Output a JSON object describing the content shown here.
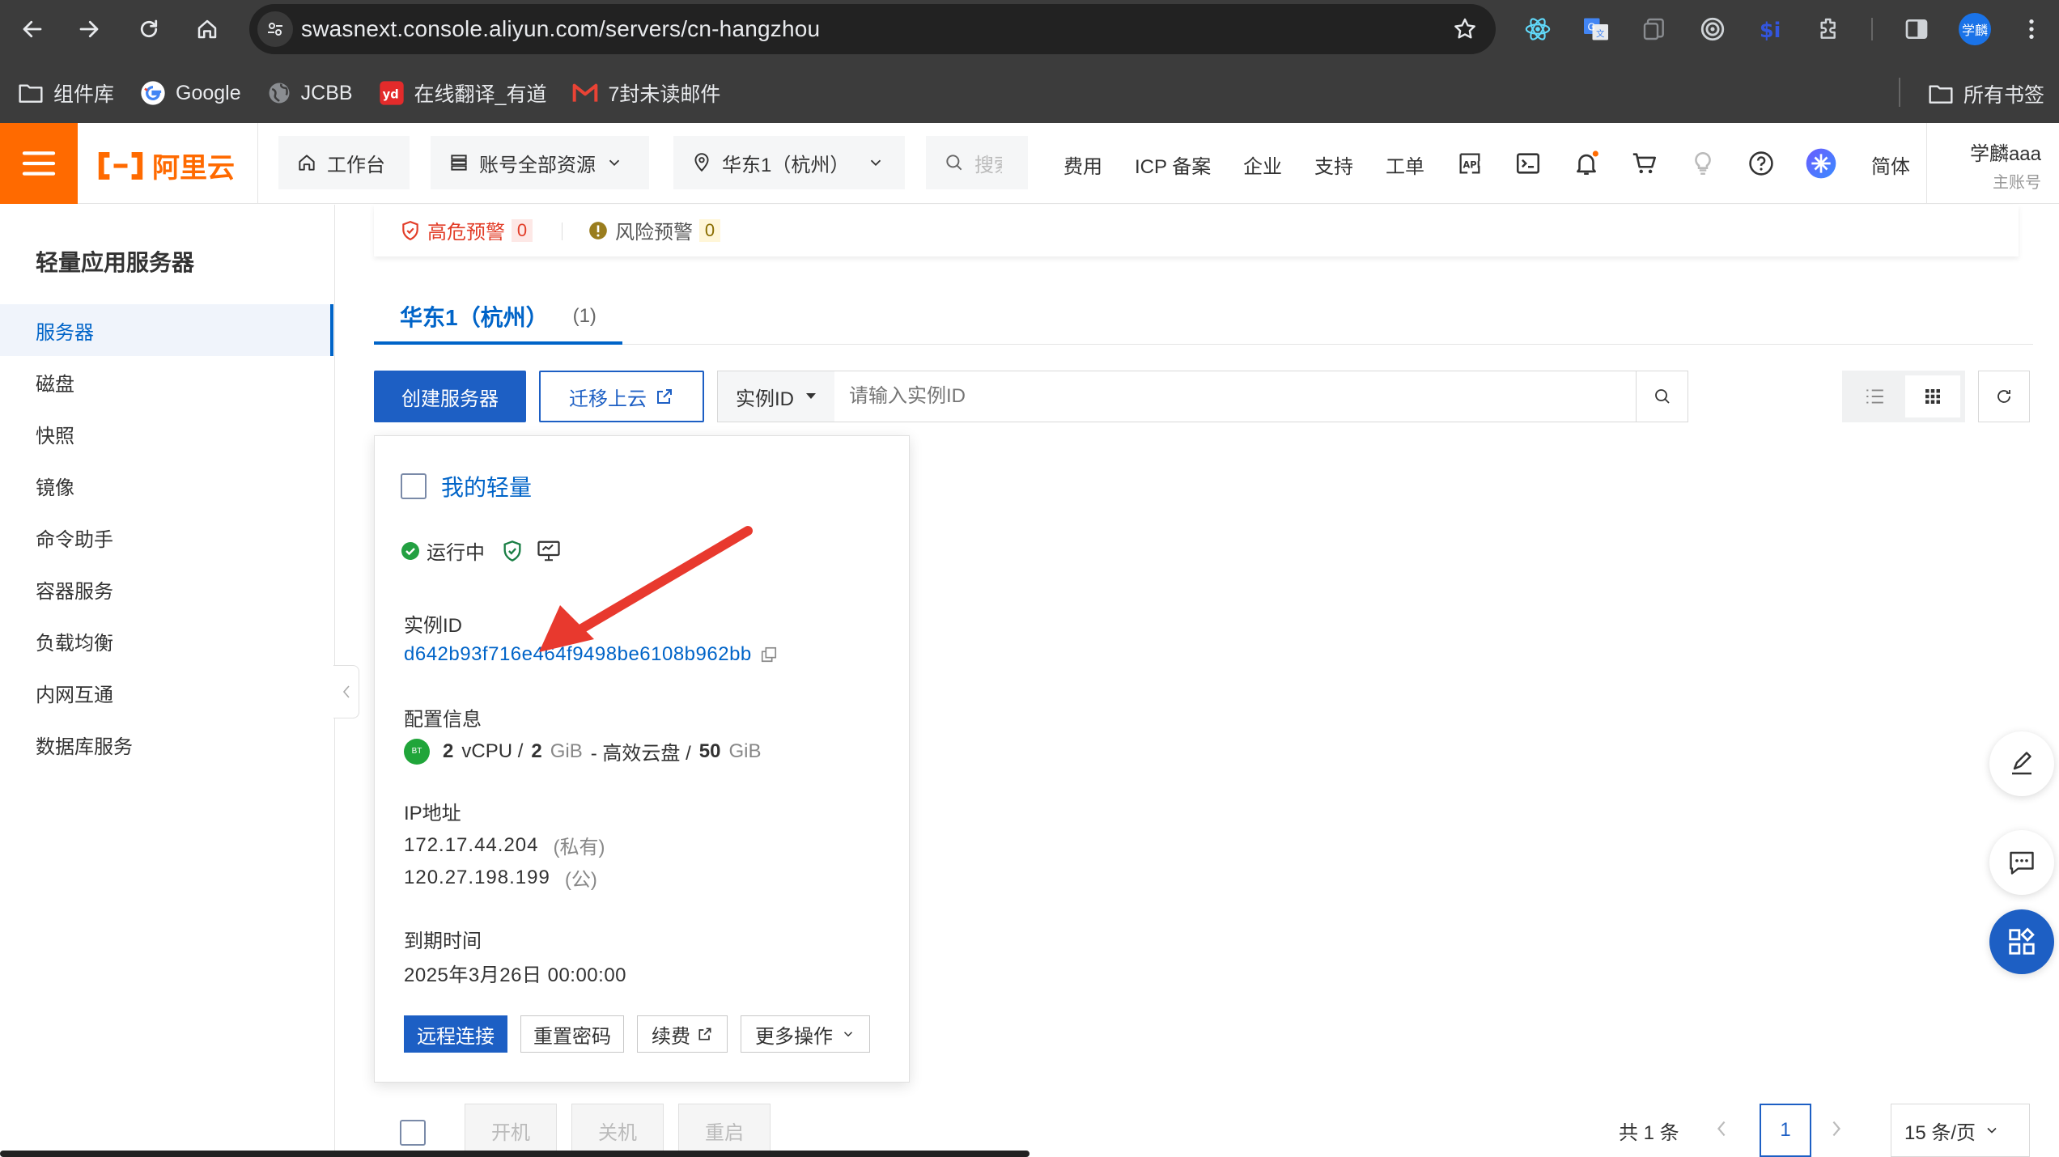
{
  "browser": {
    "url": "swasnext.console.aliyun.com/servers/cn-hangzhou",
    "bookmarks": [
      {
        "label": "组件库",
        "icon": "folder-icon"
      },
      {
        "label": "Google",
        "icon": "google-icon"
      },
      {
        "label": "JCBB",
        "icon": "globe-icon"
      },
      {
        "label": "在线翻译_有道",
        "icon": "youdao-icon"
      },
      {
        "label": "7封未读邮件",
        "icon": "mail-icon"
      }
    ],
    "all_bookmarks": "所有书签",
    "profile_initials": "学麟"
  },
  "header": {
    "logo": "阿里云",
    "workbench": "工作台",
    "resources": "账号全部资源",
    "region": "华东1（杭州）",
    "search_placeholder": "搜索",
    "links": [
      "费用",
      "ICP 备案",
      "企业",
      "支持",
      "工单"
    ],
    "language": "简体",
    "user_name": "学麟aaa",
    "user_role": "主账号"
  },
  "sidebar": {
    "title": "轻量应用服务器",
    "items": [
      "服务器",
      "磁盘",
      "快照",
      "镜像",
      "命令助手",
      "容器服务",
      "负载均衡",
      "内网互通",
      "数据库服务"
    ]
  },
  "alerts": {
    "high_label": "高危预警",
    "high_count": "0",
    "risk_label": "风险预警",
    "risk_count": "0"
  },
  "region_tab": {
    "name": "华东1（杭州）",
    "count": "(1)"
  },
  "toolbar": {
    "create_button": "创建服务器",
    "migrate_button": "迁移上云",
    "search_type": "实例ID",
    "search_placeholder": "请输入实例ID"
  },
  "server_card": {
    "name": "我的轻量",
    "status": "运行中",
    "instance_id_label": "实例ID",
    "instance_id": "d642b93f716e464f9498be6108b962bb",
    "config_label": "配置信息",
    "cpu": "2",
    "cpu_unit": "vCPU /",
    "mem": "2",
    "mem_unit": "GiB",
    "disk_type": "- 高效云盘 /",
    "disk": "50",
    "disk_unit": "GiB",
    "os_badge": "BT",
    "ip_label": "IP地址",
    "private_ip": "172.17.44.204",
    "private_tag": "(私有)",
    "public_ip": "120.27.198.199",
    "public_tag": "(公)",
    "expire_label": "到期时间",
    "expire_time": "2025年3月26日 00:00:00",
    "actions": [
      "远程连接",
      "重置密码",
      "续费",
      "更多操作"
    ]
  },
  "footer": {
    "power_buttons": [
      "开机",
      "关机",
      "重启"
    ],
    "total": "共 1 条",
    "page": "1",
    "page_size": "15 条/页"
  },
  "colors": {
    "brand_orange": "#ff6a00",
    "primary_blue": "#0064c8",
    "annotation_red": "#e8392e",
    "running_green": "#23a042"
  }
}
